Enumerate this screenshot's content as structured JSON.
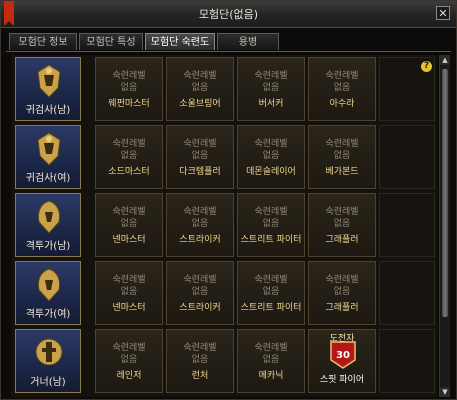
{
  "window": {
    "title": "모험단(없음)",
    "close_icon": "✕"
  },
  "tabs": [
    {
      "label": "모험단 정보"
    },
    {
      "label": "모험단 특성"
    },
    {
      "label": "모험단 숙련도"
    },
    {
      "label": "용병"
    }
  ],
  "help": {
    "icon": "?"
  },
  "scroll": {
    "up": "▲",
    "down": "▼"
  },
  "rows": [
    {
      "class_label": "귀검사(남)",
      "cells": [
        {
          "lv": "숙련레벨",
          "st": "없음",
          "nm": "웨펀마스터"
        },
        {
          "lv": "숙련레벨",
          "st": "없음",
          "nm": "소울브링어"
        },
        {
          "lv": "숙련레벨",
          "st": "없음",
          "nm": "버서커"
        },
        {
          "lv": "숙련레벨",
          "st": "없음",
          "nm": "아수라"
        }
      ]
    },
    {
      "class_label": "귀검사(여)",
      "cells": [
        {
          "lv": "숙련레벨",
          "st": "없음",
          "nm": "소드마스터"
        },
        {
          "lv": "숙련레벨",
          "st": "없음",
          "nm": "다크템플러"
        },
        {
          "lv": "숙련레벨",
          "st": "없음",
          "nm": "데몬슬레이어"
        },
        {
          "lv": "숙련레벨",
          "st": "없음",
          "nm": "베가본드"
        }
      ]
    },
    {
      "class_label": "격투가(남)",
      "cells": [
        {
          "lv": "숙련레벨",
          "st": "없음",
          "nm": "넨마스터"
        },
        {
          "lv": "숙련레벨",
          "st": "없음",
          "nm": "스트라이커"
        },
        {
          "lv": "숙련레벨",
          "st": "없음",
          "nm": "스트리트 파이터"
        },
        {
          "lv": "숙련레벨",
          "st": "없음",
          "nm": "그래플러"
        }
      ]
    },
    {
      "class_label": "격투가(여)",
      "cells": [
        {
          "lv": "숙련레벨",
          "st": "없음",
          "nm": "넨마스터"
        },
        {
          "lv": "숙련레벨",
          "st": "없음",
          "nm": "스트라이커"
        },
        {
          "lv": "숙련레벨",
          "st": "없음",
          "nm": "스트리트 파이터"
        },
        {
          "lv": "숙련레벨",
          "st": "없음",
          "nm": "그래플러"
        }
      ]
    },
    {
      "class_label": "거너(남)",
      "cells": [
        {
          "lv": "숙련레벨",
          "st": "없음",
          "nm": "레인저"
        },
        {
          "lv": "숙련레벨",
          "st": "없음",
          "nm": "런처"
        },
        {
          "lv": "숙련레벨",
          "st": "없음",
          "nm": "메카닉"
        },
        {
          "challenger_label": "도전자",
          "badge_number": "30",
          "nm": "스핏 파이어"
        }
      ]
    }
  ]
}
